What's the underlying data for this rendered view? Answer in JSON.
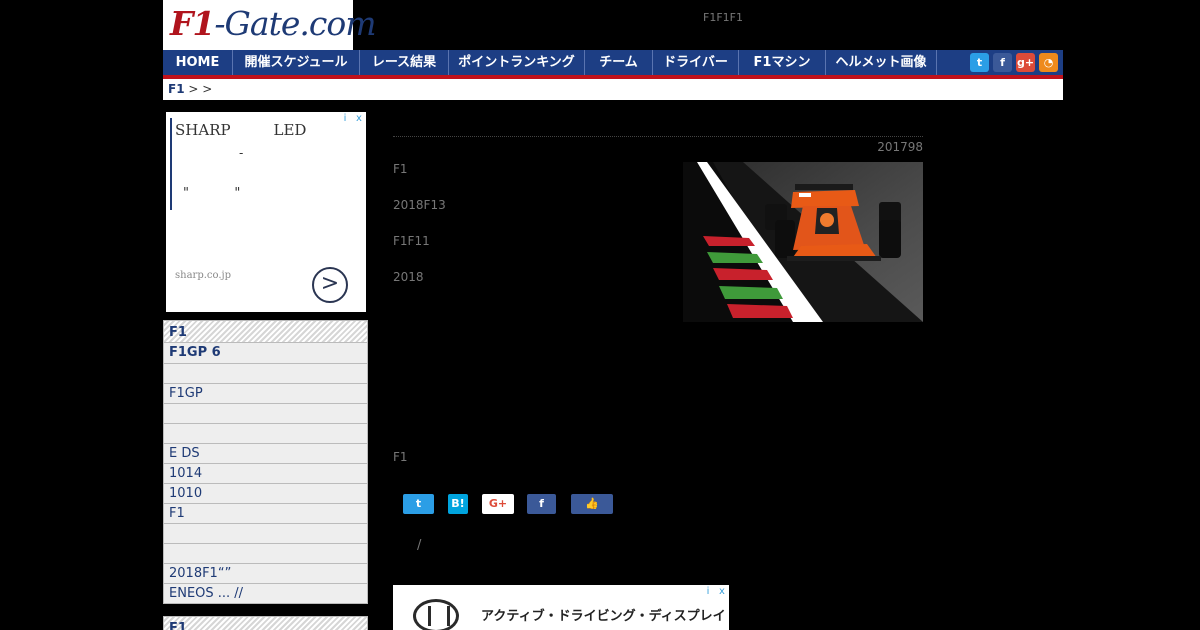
{
  "header": {
    "logo_f1": "F1",
    "logo_rest": "-Gate.com",
    "tagline": "F1F1F1"
  },
  "nav": {
    "items": [
      {
        "label": "HOME"
      },
      {
        "label": "開催スケジュール"
      },
      {
        "label": "レース結果"
      },
      {
        "label": "ポイントランキング"
      },
      {
        "label": "チーム"
      },
      {
        "label": "ドライバー"
      },
      {
        "label": "F1マシン"
      },
      {
        "label": "ヘルメット画像"
      }
    ],
    "social": [
      {
        "icon": "twitter-icon",
        "glyph": "t",
        "color": "#2b9ee6"
      },
      {
        "icon": "facebook-icon",
        "glyph": "f",
        "color": "#3b5998"
      },
      {
        "icon": "google-plus-icon",
        "glyph": "g+",
        "color": "#dd4b39"
      },
      {
        "icon": "rss-icon",
        "glyph": "◔",
        "color": "#ee8a1c"
      }
    ]
  },
  "breadcrumb": {
    "root": "F1",
    "rest": ">  >"
  },
  "side_ad": {
    "line1": "SHARP         LED",
    "line2": "-",
    "line3": "\"           \"",
    "domain": "sharp.co.jp",
    "arrow": ">",
    "info": "i",
    "close": "x"
  },
  "sidebar": {
    "head": "F1",
    "items": [
      {
        "label": "F1GP 6",
        "bold": true
      },
      {
        "label": ""
      },
      {
        "label": "F1GP"
      },
      {
        "label": ""
      },
      {
        "label": ""
      },
      {
        "label": "E DS"
      },
      {
        "label": "1014"
      },
      {
        "label": "1010"
      },
      {
        "label": "F1"
      },
      {
        "label": ""
      },
      {
        "label": ""
      },
      {
        "label": "2018F1“”"
      },
      {
        "label": "ENEOS ... //"
      }
    ],
    "head2": "F1"
  },
  "article": {
    "date": "201798",
    "paragraphs": [
      "F1",
      "2018F13",
      "F1F11",
      "2018"
    ],
    "closing": "F1",
    "slash": "/"
  },
  "share": [
    {
      "icon": "twitter-share-icon",
      "glyph": "t",
      "color": "#2b9ee6"
    },
    {
      "icon": "hatena-share-icon",
      "glyph": "B!",
      "color": "#00a4de"
    },
    {
      "icon": "google-plus-share-icon",
      "glyph": "G+",
      "color": "#ffffff",
      "text_color": "#dd4b39"
    },
    {
      "icon": "facebook-share-icon",
      "glyph": "f",
      "color": "#3b5998"
    },
    {
      "icon": "like-share-icon",
      "glyph": "👍",
      "color": "#3b5998"
    }
  ],
  "bottom_ad": {
    "text": "アクティブ・ドライビング・ディスプレイ",
    "info": "i",
    "close": "x"
  }
}
